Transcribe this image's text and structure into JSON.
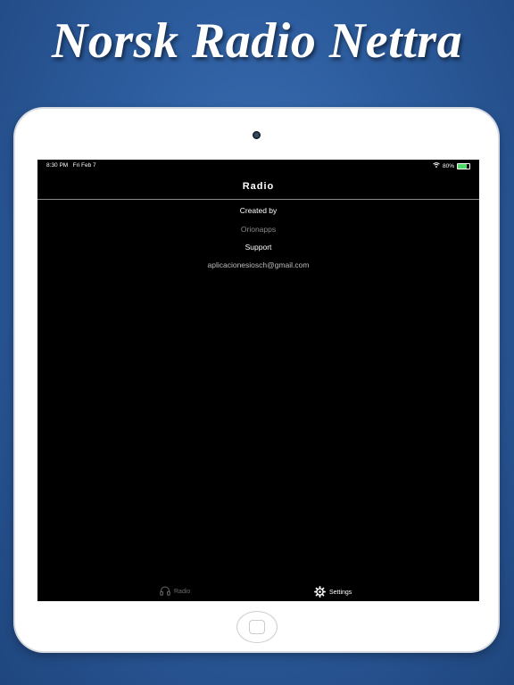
{
  "banner": {
    "title": "Norsk Radio Nettra"
  },
  "status_bar": {
    "time": "8:30 PM",
    "date": "Fri Feb 7",
    "battery_label": "80%",
    "battery_level": 0.8,
    "wifi_icon": "wifi-icon"
  },
  "nav": {
    "title": "Radio"
  },
  "about": {
    "created_by_label": "Created by",
    "creator": "Orionapps",
    "support_label": "Support",
    "email": "aplicacionesiosch@gmail.com"
  },
  "tab_bar": {
    "tabs": [
      {
        "label": "Radio",
        "icon": "headphones-icon",
        "active": false
      },
      {
        "label": "Settings",
        "icon": "gear-icon",
        "active": true
      }
    ]
  },
  "colors": {
    "background": "#2d5d9f",
    "screen": "#000000",
    "device": "#ffffff",
    "battery": "#4cd964"
  }
}
